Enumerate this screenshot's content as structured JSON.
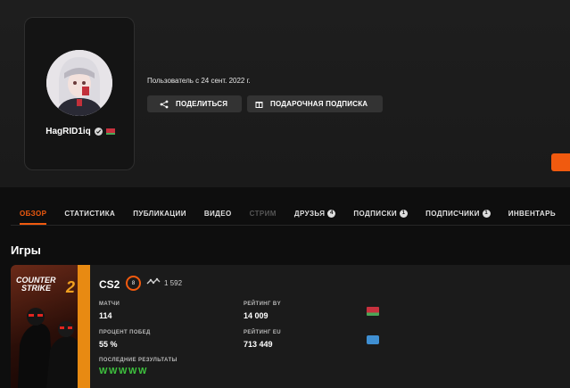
{
  "profile": {
    "username": "HagRID1iq",
    "since": "Пользователь с 24 сент. 2022 г.",
    "share_label": "ПОДЕЛИТЬСЯ",
    "gift_label": "ПОДАРОЧНАЯ ПОДПИСКА"
  },
  "tabs": [
    {
      "label": "ОБЗОР",
      "active": true
    },
    {
      "label": "СТАТИСТИКА"
    },
    {
      "label": "ПУБЛИКАЦИИ"
    },
    {
      "label": "ВИДЕО"
    },
    {
      "label": "СТРИМ",
      "disabled": true
    },
    {
      "label": "ДРУЗЬЯ",
      "count": "4"
    },
    {
      "label": "ПОДПИСКИ",
      "count": "1"
    },
    {
      "label": "ПОДПИСЧИКИ",
      "count": "1"
    },
    {
      "label": "ИНВЕНТАРЬ"
    }
  ],
  "games": {
    "title": "Игры",
    "cs2": {
      "name": "CS2",
      "level": "8",
      "elo": "1 592",
      "matches_label": "МАТЧИ",
      "matches": "114",
      "winrate_label": "ПРОЦЕНТ ПОБЕД",
      "winrate": "55 %",
      "rating_by_label": "РЕЙТИНГ BY",
      "rating_by": "14 009",
      "rating_eu_label": "РЕЙТИНГ EU",
      "rating_eu": "713 449",
      "recent_label": "ПОСЛЕДНИЕ РЕЗУЛЬТАТЫ",
      "recent": [
        "W",
        "W",
        "W",
        "W",
        "W"
      ],
      "cover_text_1": "COUNTER",
      "cover_text_2": "STRIKE",
      "cover_number": "2"
    }
  },
  "colors": {
    "accent": "#f05a0f",
    "win": "#3ec33e",
    "background": "#0e0e0e"
  }
}
